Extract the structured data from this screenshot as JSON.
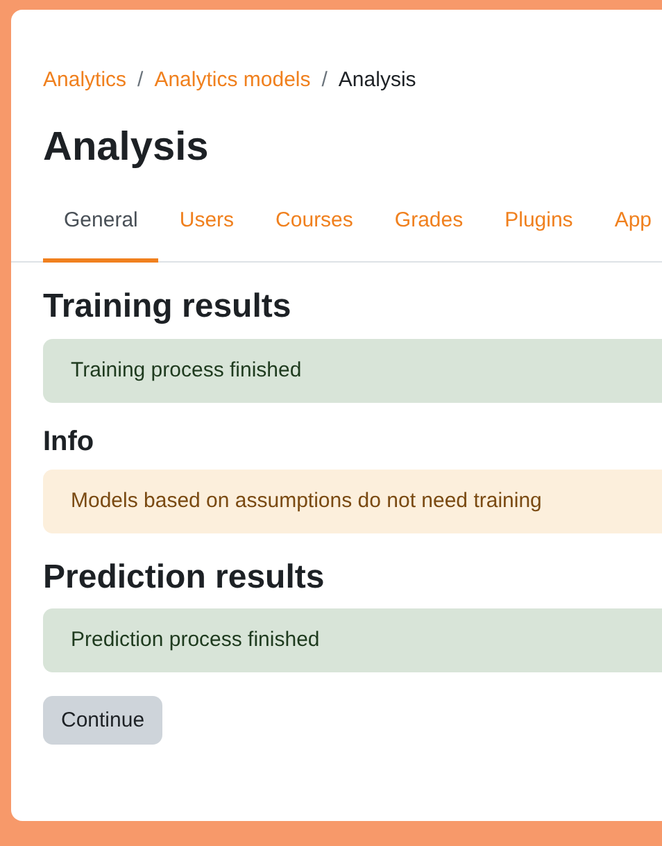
{
  "breadcrumb": [
    {
      "label": "Analytics",
      "kind": "link"
    },
    {
      "label": "Analytics models",
      "kind": "link"
    },
    {
      "label": "Analysis",
      "kind": "current"
    }
  ],
  "separator": "/",
  "title": "Analysis",
  "tabs": [
    {
      "label": "General",
      "selected": true
    },
    {
      "label": "Users",
      "selected": false
    },
    {
      "label": "Courses",
      "selected": false
    },
    {
      "label": "Grades",
      "selected": false
    },
    {
      "label": "Plugins",
      "selected": false
    },
    {
      "label": "App",
      "selected": false
    }
  ],
  "sections": [
    {
      "heading": "Training results",
      "kind": "major",
      "notice": {
        "kind": "success",
        "text": "Training process finished"
      }
    },
    {
      "heading": "Info",
      "kind": "minor",
      "notice": {
        "kind": "warning",
        "text": "Models based on assumptions do not need training"
      }
    },
    {
      "heading": "Prediction results",
      "kind": "major",
      "notice": {
        "kind": "success",
        "text": "Prediction process finished"
      }
    }
  ],
  "button": {
    "label": "Continue"
  }
}
